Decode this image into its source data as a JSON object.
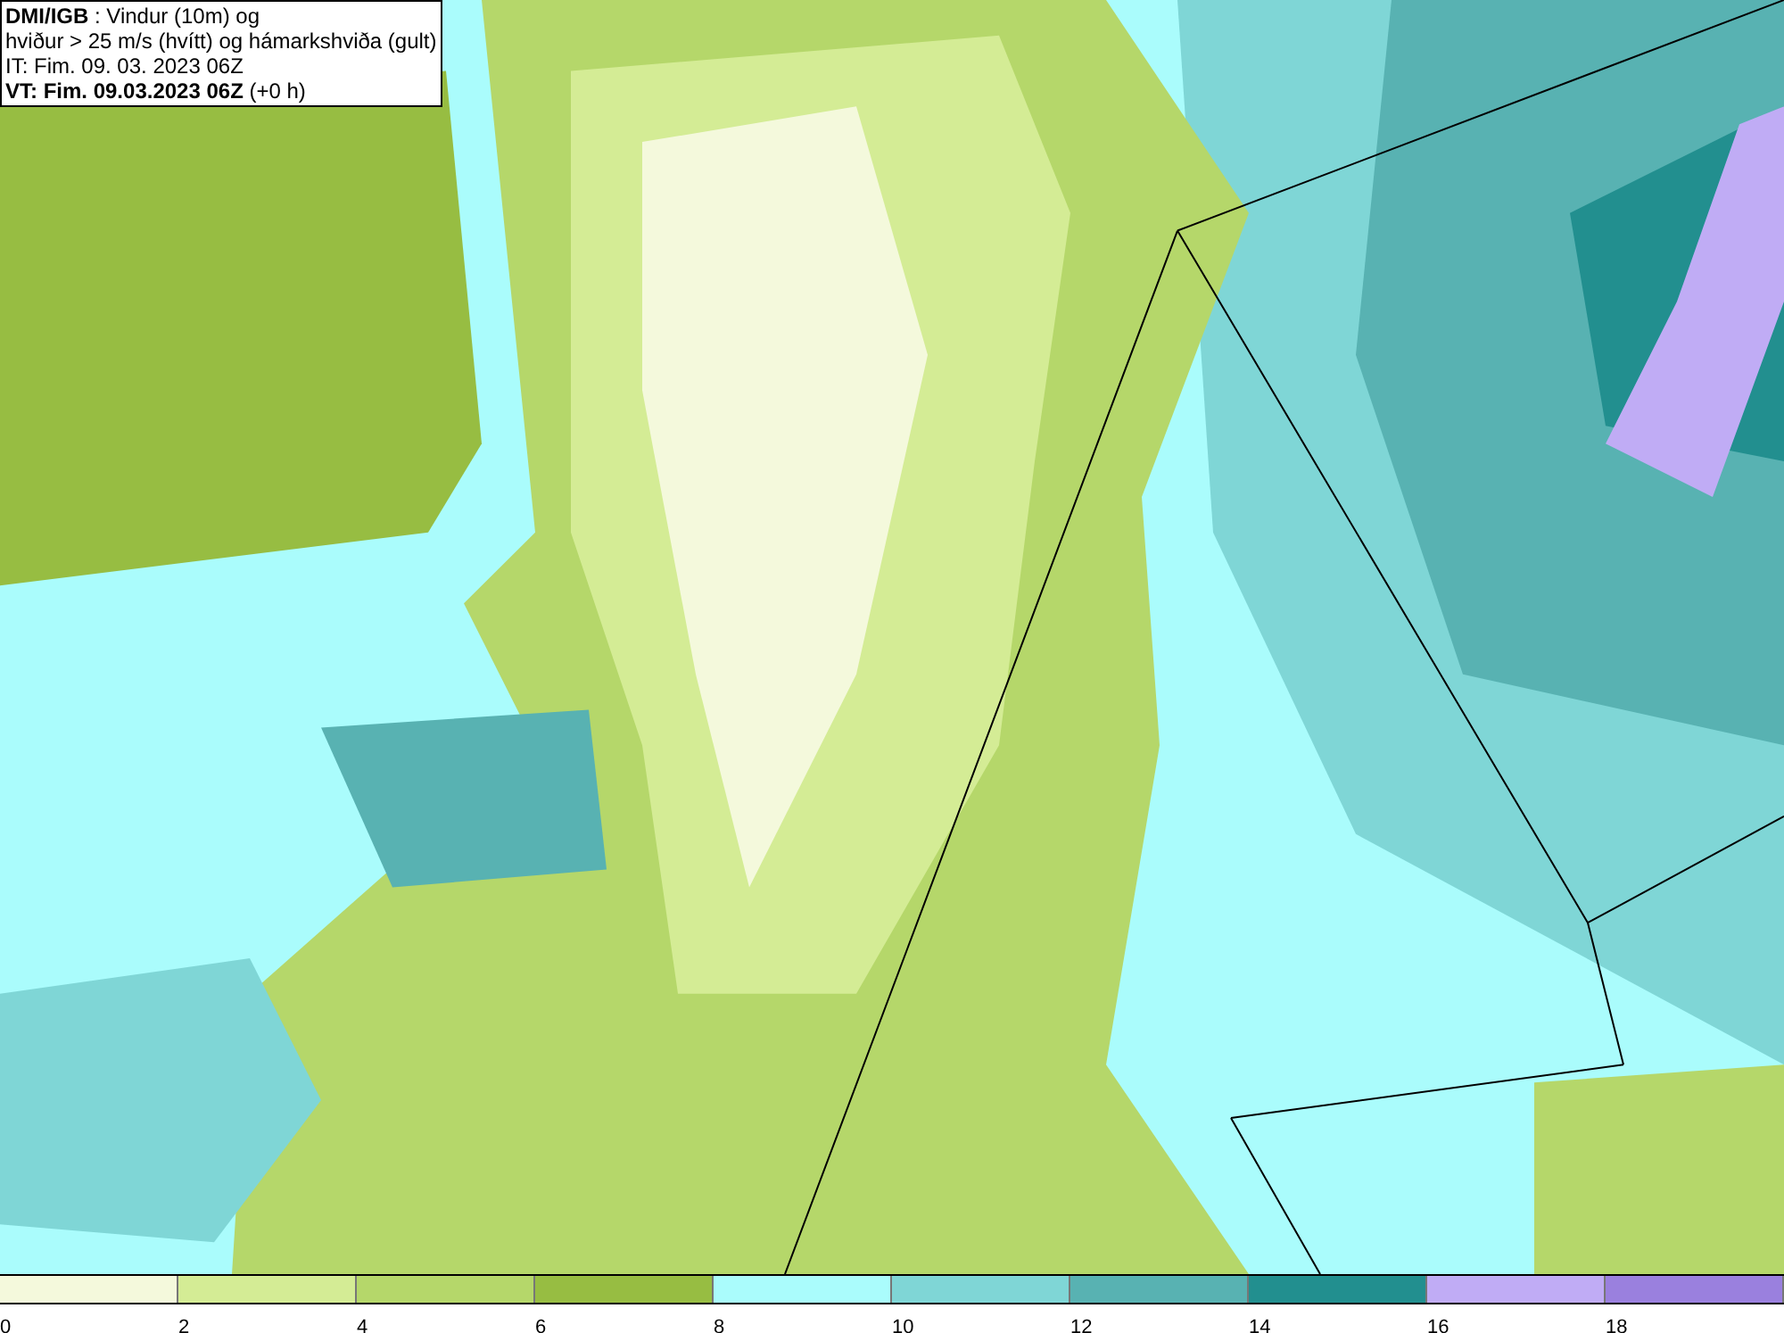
{
  "header": {
    "lines": [
      "**DMI/IGB** : Vindur (10m) og",
      "hviður > 25 m/s (hvítt) og hámarkshviða (gult)",
      "IT: Fim. 09. 03. 2023 06Z",
      "**VT: Fim. 09.03.2023 06Z** (+0 h)"
    ]
  },
  "legend": {
    "bins": [
      {
        "label": "0",
        "color": "#f4f9dc"
      },
      {
        "label": "2",
        "color": "#d4ec95"
      },
      {
        "label": "4",
        "color": "#b5d76a"
      },
      {
        "label": "6",
        "color": "#97bd42"
      },
      {
        "label": "8",
        "color": "#aafcfc"
      },
      {
        "label": "10",
        "color": "#7fd6d6"
      },
      {
        "label": "12",
        "color": "#58b2b2"
      },
      {
        "label": "14",
        "color": "#228f8f"
      },
      {
        "label": "16",
        "color": "#c0acf5"
      },
      {
        "label": "18",
        "color": "#9a80de"
      }
    ]
  }
}
